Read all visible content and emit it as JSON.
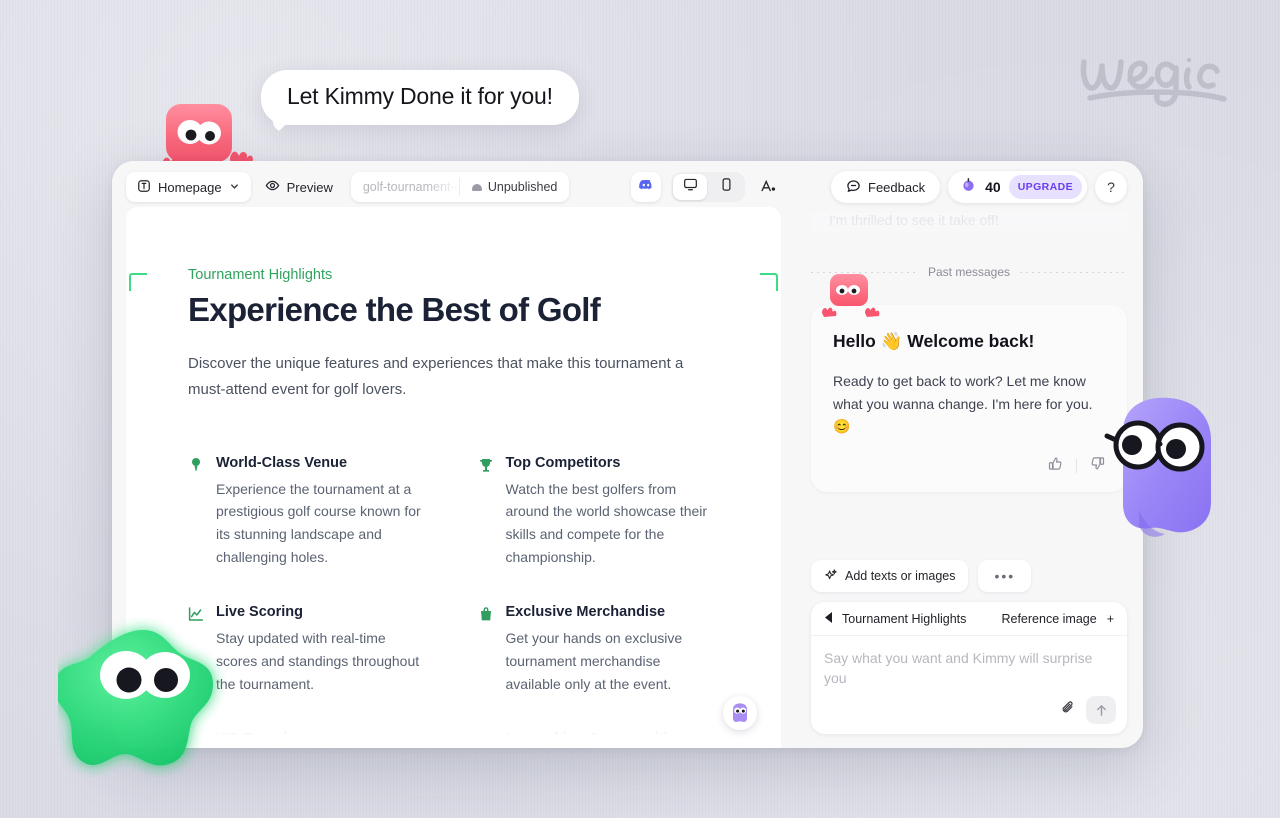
{
  "brand": {
    "logo_text": "wegic"
  },
  "callout": {
    "text": "Let Kimmy Done it for you!",
    "mascot": "pink-blob-mascot"
  },
  "editor": {
    "toolbar": {
      "page_selector": {
        "label": "Homepage",
        "icon": "page-icon",
        "chevron": "chevron-down-icon"
      },
      "preview": {
        "label": "Preview",
        "icon": "eye-icon"
      },
      "url": "golf-tournament-extra",
      "publish_state": {
        "label": "Unpublished",
        "icon": "cloud-icon"
      },
      "discord": "discord-icon",
      "device_desktop": "desktop-icon",
      "device_mobile": "mobile-icon",
      "typography": "typography-icon"
    },
    "page": {
      "eyebrow": "Tournament Highlights",
      "heading": "Experience the Best of Golf",
      "lead": "Discover the unique features and experiences that make this tournament a must-attend event for golf lovers.",
      "features": [
        {
          "icon": "golf-tee-icon",
          "title": "World-Class Venue",
          "body": "Experience the tournament at a prestigious golf course known for its stunning landscape and challenging holes."
        },
        {
          "icon": "trophy-icon",
          "title": "Top Competitors",
          "body": "Watch the best golfers from around the world showcase their skills and compete for the championship."
        },
        {
          "icon": "chart-line-icon",
          "title": "Live Scoring",
          "body": "Stay updated with real-time scores and standings throughout the tournament."
        },
        {
          "icon": "shopping-bag-icon",
          "title": "Exclusive Merchandise",
          "body": "Get your hands on exclusive tournament merchandise available only at the event."
        },
        {
          "icon": "crown-icon",
          "title": "VIP Experience",
          "body": ""
        },
        {
          "icon": "people-icon",
          "title": "Networking Opportunities",
          "body": ""
        }
      ]
    }
  },
  "chat": {
    "header": {
      "feedback_label": "Feedback",
      "credits_count": "40",
      "upgrade_label": "UPGRADE",
      "help_label": "?"
    },
    "ghost_message": "I'm thrilled to see it take off!",
    "divider_label": "Past messages",
    "message": {
      "title": "Hello 👋 Welcome back!",
      "body": "Ready to get back to work? Let me know what you wanna change. I'm here for you. 😊",
      "thumbs_up": "thumbs-up-icon",
      "thumbs_down": "thumbs-down-icon"
    },
    "composer": {
      "add_chip": "Add texts or images",
      "more_chip": "•••",
      "context_label": "Tournament Highlights",
      "reference_label": "Reference image",
      "reference_add": "+",
      "placeholder": "Say what you want and Kimmy will surprise you",
      "attach": "paperclip-icon",
      "send": "send-arrow-icon"
    }
  },
  "mascots": {
    "green": "green-blob-mascot",
    "purple": "purple-ghost-glasses-mascot",
    "mini_purple": "purple-mini-avatar"
  },
  "colors": {
    "accent_green": "#2f9e5e",
    "accent_purple": "#6a3ff0",
    "upgrade_bg": "#e7e0ff",
    "backdrop": "#dcdde6",
    "heading": "#1b2236"
  }
}
